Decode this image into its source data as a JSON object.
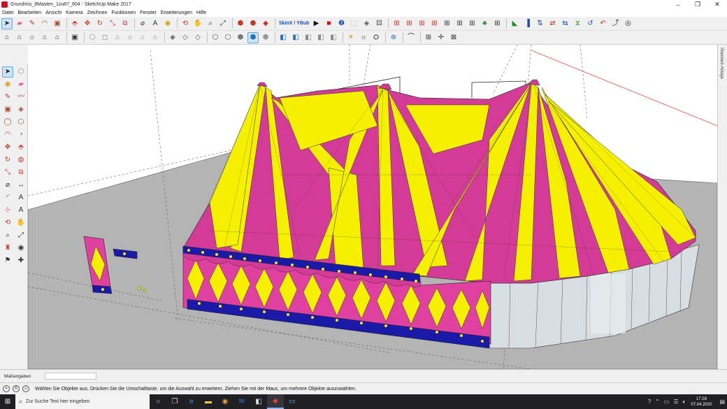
{
  "window": {
    "title": "Grundriss_8Masten_1zu87_604 - SketchUp Make 2017",
    "controls": {
      "minimize": "–",
      "maximize": "❐",
      "close": "✕"
    }
  },
  "menu": [
    "Datei",
    "Bearbeiten",
    "Ansicht",
    "Kamera",
    "Zeichnen",
    "Funktionen",
    "Fenster",
    "Erweiterungen",
    "Hilfe"
  ],
  "toolbar": {
    "skinx_label": "SkinX / YBub",
    "row1_icons": [
      "select-icon",
      "eraser-icon",
      "pencil-icon",
      "arc-icon",
      "rectangle-icon",
      "push-pull-icon",
      "move-icon",
      "rotate-icon",
      "scale-icon",
      "offset-icon",
      "tape-measure-icon",
      "text-icon",
      "paint-bucket-icon",
      "orbit-icon",
      "pan-icon",
      "zoom-icon",
      "zoom-extents-icon",
      "component-icon",
      "3d-warehouse-icon",
      "extension-icon"
    ],
    "row2_icons": [
      "home-icon",
      "house-icon",
      "component-icon",
      "iso-view-icon",
      "top-view-icon",
      "front-view-icon",
      "right-view-icon",
      "back-view-icon",
      "left-view-icon",
      "xray-icon",
      "wireframe-icon",
      "hidden-line-icon",
      "shaded-icon",
      "textured-icon",
      "monochrome-icon",
      "section-plane-icon",
      "section-cut-icon",
      "grid-icon",
      "axes-icon",
      "solar-icon"
    ]
  },
  "left_tools": [
    "select-icon",
    "component-icon",
    "paint-bucket-icon",
    "eraser-icon",
    "line-icon",
    "freehand-icon",
    "rectangle-icon",
    "rotated-rectangle-icon",
    "circle-icon",
    "polygon-icon",
    "arc-icon",
    "pie-icon",
    "move-icon",
    "push-pull-icon",
    "rotate-icon",
    "follow-me-icon",
    "scale-icon",
    "offset-icon",
    "tape-measure-icon",
    "dimension-icon",
    "protractor-icon",
    "text-icon",
    "axes-icon",
    "3d-text-icon",
    "orbit-icon",
    "pan-icon",
    "zoom-icon",
    "zoom-extents-icon",
    "position-camera-icon",
    "look-around-icon",
    "walk-icon",
    "section-plane-icon"
  ],
  "tray": {
    "label": "Standard-Ablage"
  },
  "measurements": {
    "label": "Maßangaben",
    "value": ""
  },
  "status": {
    "hint": "Wählen Sie Objekte aus. Drücken Sie die Umschalttaste, um die Auswahl zu erweitern. Ziehen Sie mit der Maus, um mehrere Objekte auszuwählen."
  },
  "taskbar": {
    "search_placeholder": "Zur Suche Text hier eingeben",
    "time": "17:28",
    "date": "07.04.2020"
  },
  "colors": {
    "tent_magenta": "#d43b96",
    "tent_yellow": "#f4f000",
    "tent_navy": "#1a1aa8",
    "ground": "#b4b4b4",
    "sky": "#ffffff",
    "wall_gray": "#d8dde2"
  }
}
